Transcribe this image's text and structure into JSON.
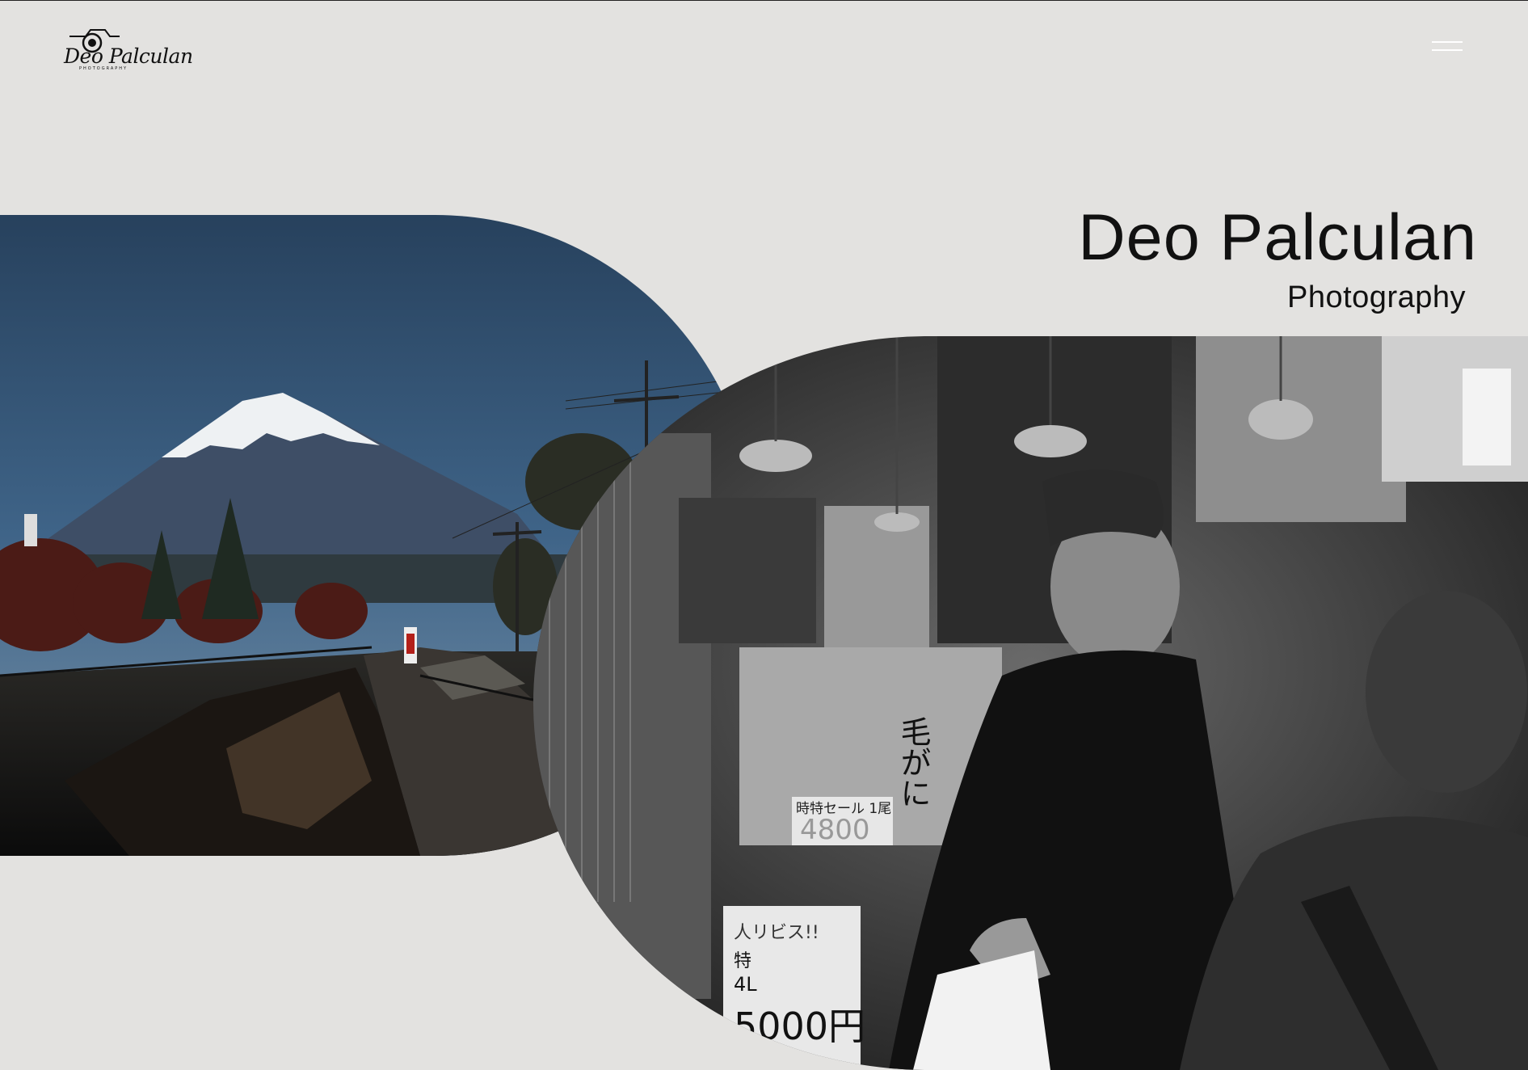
{
  "logo": {
    "script_text": "Deo Palculan",
    "sub_text": "PHOTOGRAPHY"
  },
  "hero": {
    "title": "Deo Palculan",
    "subtitle": "Photography"
  },
  "images": {
    "left": "mount-fuji-autumn-photo",
    "right": "street-market-vendor-bw-photo"
  },
  "market_signs": {
    "sign_top": "時特セール 1尾",
    "price_old": "4800",
    "crab_label": "毛がに",
    "sign_bottom_line1": "人リビス!!",
    "sign_bottom_line2": "特",
    "sign_bottom_line3": "4L",
    "price_new": "5000円"
  },
  "colors": {
    "background": "#e3e2e0",
    "text": "#111111",
    "menu": "#ffffff"
  }
}
